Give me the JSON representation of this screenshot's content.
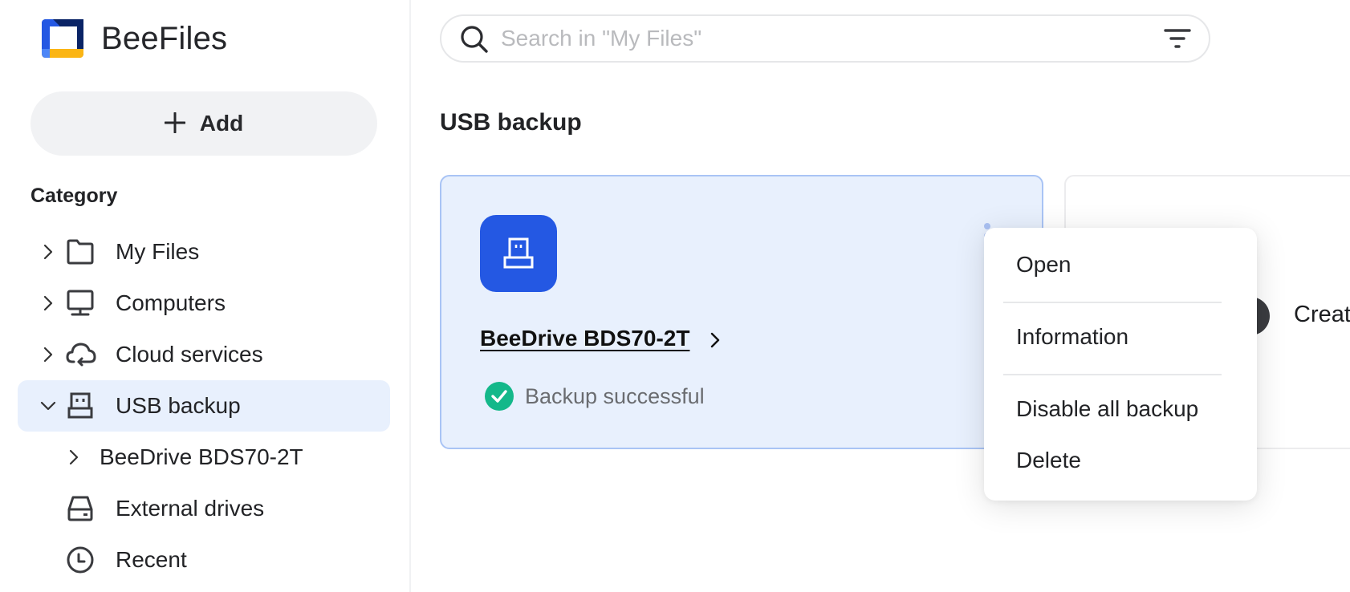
{
  "app": {
    "name": "BeeFiles",
    "logo_colors": {
      "primary": "#2458e3",
      "dark": "#0a2466",
      "accent": "#fbb514",
      "light": "#4d86f7"
    }
  },
  "sidebar": {
    "add_label": "Add",
    "add_icon": "plus-icon",
    "category_title": "Category",
    "items": [
      {
        "label": "My Files",
        "icon": "folder-icon",
        "expander": "chevron-right",
        "active": false
      },
      {
        "label": "Computers",
        "icon": "monitor-icon",
        "expander": "chevron-right",
        "active": false
      },
      {
        "label": "Cloud services",
        "icon": "cloud-sync-icon",
        "expander": "chevron-right",
        "active": false
      },
      {
        "label": "USB backup",
        "icon": "usb-drive-icon",
        "expander": "chevron-down",
        "active": true
      },
      {
        "label": "BeeDrive BDS70-2T",
        "icon": null,
        "expander": "chevron-right",
        "active": false,
        "child": true
      },
      {
        "label": "External drives",
        "icon": "hard-drive-icon",
        "expander": null,
        "active": false
      },
      {
        "label": "Recent",
        "icon": "clock-icon",
        "expander": null,
        "active": false
      }
    ]
  },
  "search": {
    "placeholder": "Search in \"My Files\"",
    "value": ""
  },
  "main": {
    "title": "USB backup",
    "cards": [
      {
        "device_name": "BeeDrive BDS70-2T",
        "status": "Backup successful",
        "status_color": "#14b88a",
        "icon_bg": "#2458e3"
      }
    ],
    "create_card_label": "Creat"
  },
  "context_menu": {
    "items": [
      "Open",
      "Information",
      "Disable all backup",
      "Delete"
    ]
  },
  "colors": {
    "active_bg": "#e8f0fd",
    "card_border": "#a9c4f5",
    "text": "#222326"
  }
}
